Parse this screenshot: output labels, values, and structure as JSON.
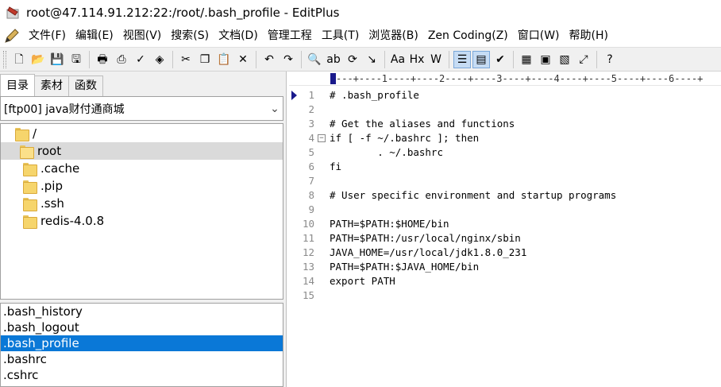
{
  "window": {
    "title": "root@47.114.91.212:22:/root/.bash_profile - EditPlus"
  },
  "menu": [
    "文件(F)",
    "编辑(E)",
    "视图(V)",
    "搜索(S)",
    "文档(D)",
    "管理工程",
    "工具(T)",
    "浏览器(B)",
    "Zen Coding(Z)",
    "窗口(W)",
    "帮助(H)"
  ],
  "toolbar": {
    "buttons": [
      {
        "icon": "new-file-icon",
        "glyph": "🗋"
      },
      {
        "icon": "open-folder-icon",
        "glyph": "📂"
      },
      {
        "icon": "save-icon",
        "glyph": "💾"
      },
      {
        "icon": "save-all-icon",
        "glyph": "🖫"
      },
      {
        "icon": "print-preview-icon",
        "glyph": "🖶"
      },
      {
        "icon": "print-icon",
        "glyph": "⎙"
      },
      {
        "icon": "spellcheck-icon",
        "glyph": "✓"
      },
      {
        "icon": "browser-preview-icon",
        "glyph": "◈"
      },
      {
        "icon": "cut-icon",
        "glyph": "✂"
      },
      {
        "icon": "copy-icon",
        "glyph": "❐"
      },
      {
        "icon": "paste-icon",
        "glyph": "📋"
      },
      {
        "icon": "delete-icon",
        "glyph": "✕"
      },
      {
        "icon": "undo-icon",
        "glyph": "↶"
      },
      {
        "icon": "redo-icon",
        "glyph": "↷"
      },
      {
        "icon": "find-icon",
        "glyph": "🔍"
      },
      {
        "icon": "replace-icon",
        "glyph": "ab"
      },
      {
        "icon": "find-in-files-icon",
        "glyph": "⟳"
      },
      {
        "icon": "goto-line-icon",
        "glyph": "↘"
      },
      {
        "icon": "font-size-icon",
        "glyph": "Aa"
      },
      {
        "icon": "hex-icon",
        "glyph": "Hx"
      },
      {
        "icon": "word-wrap-icon",
        "glyph": "W"
      },
      {
        "icon": "line-numbers-icon",
        "glyph": "☰"
      },
      {
        "icon": "column-ruler-icon",
        "glyph": "▤"
      },
      {
        "icon": "check-icon",
        "glyph": "✔"
      },
      {
        "icon": "cliptext-icon",
        "glyph": "▦"
      },
      {
        "icon": "directory-window-icon",
        "glyph": "▣"
      },
      {
        "icon": "output-window-icon",
        "glyph": "▧"
      },
      {
        "icon": "fullscreen-icon",
        "glyph": "⤢"
      },
      {
        "icon": "help-icon",
        "glyph": "?"
      }
    ]
  },
  "left_panel": {
    "tabs": [
      "目录",
      "素材",
      "函数"
    ],
    "directory_select": "[ftp00] java财付通商城",
    "tree": [
      {
        "label": "/",
        "indent": 1
      },
      {
        "label": "root",
        "indent": 2,
        "selected": true
      },
      {
        "label": ".cache",
        "indent": 3
      },
      {
        "label": ".pip",
        "indent": 3
      },
      {
        "label": ".ssh",
        "indent": 3
      },
      {
        "label": "redis-4.0.8",
        "indent": 3
      }
    ],
    "files": [
      {
        "label": ".bash_history"
      },
      {
        "label": ".bash_logout"
      },
      {
        "label": ".bash_profile",
        "selected": true
      },
      {
        "label": ".bashrc"
      },
      {
        "label": ".cshrc"
      }
    ]
  },
  "editor": {
    "ruler": "---+----1----+----2----+----3----+----4----+----5----+----6----+",
    "lines": [
      {
        "n": "1",
        "text": "# .bash_profile"
      },
      {
        "n": "2",
        "text": ""
      },
      {
        "n": "3",
        "text": "# Get the aliases and functions"
      },
      {
        "n": "4",
        "text": "if [ -f ~/.bashrc ]; then",
        "fold": "−"
      },
      {
        "n": "5",
        "text": "        . ~/.bashrc"
      },
      {
        "n": "6",
        "text": "fi"
      },
      {
        "n": "7",
        "text": ""
      },
      {
        "n": "8",
        "text": "# User specific environment and startup programs"
      },
      {
        "n": "9",
        "text": ""
      },
      {
        "n": "10",
        "text": "PATH=$PATH:$HOME/bin"
      },
      {
        "n": "11",
        "text": "PATH=$PATH:/usr/local/nginx/sbin"
      },
      {
        "n": "12",
        "text": "JAVA_HOME=/usr/local/jdk1.8.0_231"
      },
      {
        "n": "13",
        "text": "PATH=$PATH:$JAVA_HOME/bin"
      },
      {
        "n": "14",
        "text": "export PATH"
      },
      {
        "n": "15",
        "text": ""
      }
    ]
  }
}
